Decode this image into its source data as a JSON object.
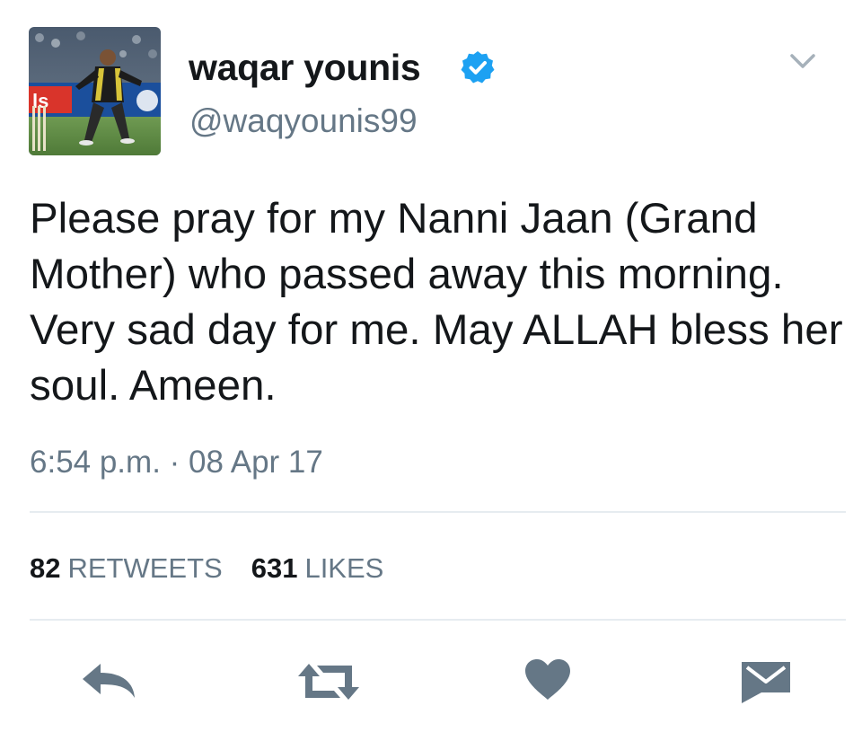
{
  "tweet": {
    "author": {
      "display_name": "waqar younis",
      "handle": "@waqyounis99",
      "avatar": "avatar-photo",
      "verified_icon": "verified-badge-icon"
    },
    "menu_icon": "chevron-down-icon",
    "text": "Please pray for my Nanni Jaan (Grand Mother) who passed away this morning. Very sad day for me. May ALLAH bless her soul. Ameen.",
    "timestamp": "6:54 p.m. · 08 Apr 17",
    "stats": {
      "retweets_count": "82",
      "retweets_label": "RETWEETS",
      "likes_count": "631",
      "likes_label": "LIKES"
    },
    "actions": [
      {
        "name": "reply",
        "icon": "reply-icon"
      },
      {
        "name": "retweet",
        "icon": "retweet-icon"
      },
      {
        "name": "like",
        "icon": "heart-icon"
      },
      {
        "name": "direct-message",
        "icon": "envelope-icon"
      }
    ]
  },
  "colors": {
    "text_primary": "#14171a",
    "text_secondary": "#657786",
    "verified_blue": "#1da1f2",
    "action_icon": "#657786",
    "divider": "#e6ecf0"
  }
}
